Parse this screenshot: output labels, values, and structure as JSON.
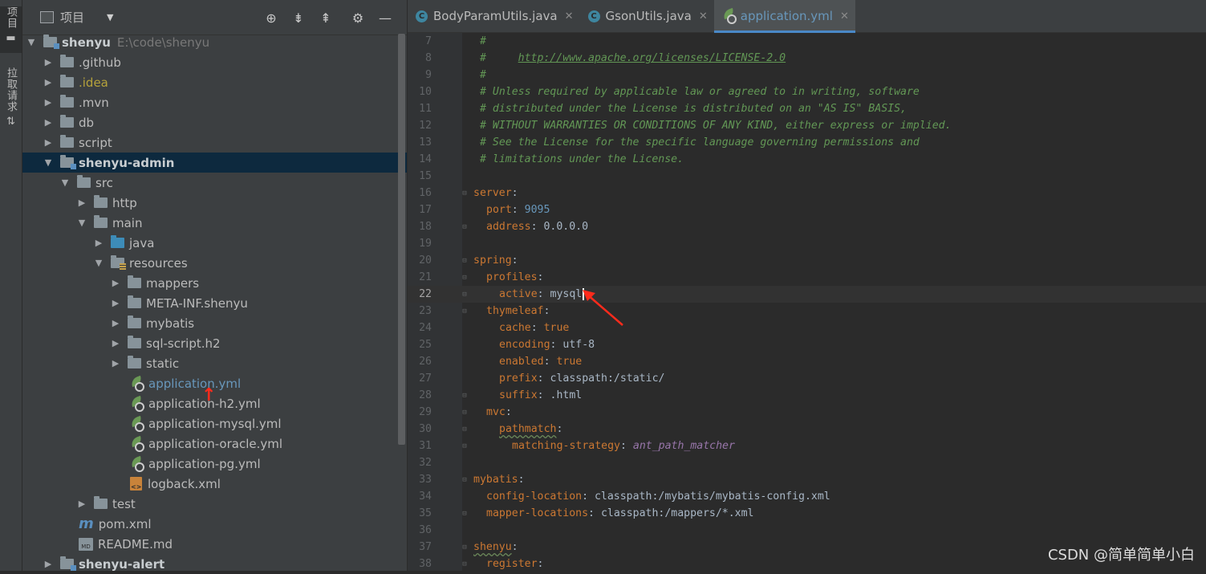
{
  "tool_strip": {
    "project_tab": "项目",
    "pull_requests_tab": "拉取请求"
  },
  "project_panel": {
    "title": "项目",
    "tools": [
      "locate-icon",
      "expand-all-icon",
      "collapse-all-icon",
      "gear-icon",
      "minimize-icon"
    ]
  },
  "tree": [
    {
      "label": "shenyu",
      "path": "E:\\code\\shenyu"
    },
    {
      "label": ".github"
    },
    {
      "label": ".idea"
    },
    {
      "label": ".mvn"
    },
    {
      "label": "db"
    },
    {
      "label": "script"
    },
    {
      "label": "shenyu-admin"
    },
    {
      "label": "src"
    },
    {
      "label": "http"
    },
    {
      "label": "main"
    },
    {
      "label": "java"
    },
    {
      "label": "resources"
    },
    {
      "label": "mappers"
    },
    {
      "label": "META-INF.shenyu"
    },
    {
      "label": "mybatis"
    },
    {
      "label": "sql-script.h2"
    },
    {
      "label": "static"
    },
    {
      "label": "application.yml"
    },
    {
      "label": "application-h2.yml"
    },
    {
      "label": "application-mysql.yml"
    },
    {
      "label": "application-oracle.yml"
    },
    {
      "label": "application-pg.yml"
    },
    {
      "label": "logback.xml"
    },
    {
      "label": "test"
    },
    {
      "label": "pom.xml"
    },
    {
      "label": "README.md"
    },
    {
      "label": "shenyu-alert"
    }
  ],
  "editor_tabs": [
    {
      "label": "BodyParamUtils.java",
      "icon": "java-class-icon"
    },
    {
      "label": "GsonUtils.java",
      "icon": "java-class-icon"
    },
    {
      "label": "application.yml",
      "icon": "spring-yml-icon"
    }
  ],
  "code": {
    "l7": {
      "n": "7",
      "c": "#"
    },
    "l8": {
      "n": "8",
      "pre": "#     ",
      "url": "http://www.apache.org/licenses/LICENSE-2.0"
    },
    "l9": {
      "n": "9",
      "c": "#"
    },
    "l10": {
      "n": "10",
      "c": "# Unless required by applicable law or agreed to in writing, software"
    },
    "l11": {
      "n": "11",
      "c": "# distributed under the License is distributed on an \"AS IS\" BASIS,"
    },
    "l12": {
      "n": "12",
      "c": "# WITHOUT WARRANTIES OR CONDITIONS OF ANY KIND, either express or implied."
    },
    "l13": {
      "n": "13",
      "c": "# See the License for the specific language governing permissions and"
    },
    "l14": {
      "n": "14",
      "c": "# limitations under the License."
    },
    "l15": {
      "n": "15"
    },
    "l16": {
      "n": "16",
      "k": "server"
    },
    "l17": {
      "n": "17",
      "k": "port",
      "v": "9095"
    },
    "l18": {
      "n": "18",
      "k": "address",
      "v": "0.0.0.0"
    },
    "l19": {
      "n": "19"
    },
    "l20": {
      "n": "20",
      "k": "spring"
    },
    "l21": {
      "n": "21",
      "k": "profiles"
    },
    "l22": {
      "n": "22",
      "k": "active",
      "v": "mysql"
    },
    "l23": {
      "n": "23",
      "k": "thymeleaf"
    },
    "l24": {
      "n": "24",
      "k": "cache",
      "v": "true"
    },
    "l25": {
      "n": "25",
      "k": "encoding",
      "v": "utf-8"
    },
    "l26": {
      "n": "26",
      "k": "enabled",
      "v": "true"
    },
    "l27": {
      "n": "27",
      "k": "prefix",
      "v": "classpath:/static/"
    },
    "l28": {
      "n": "28",
      "k": "suffix",
      "v": ".html"
    },
    "l29": {
      "n": "29",
      "k": "mvc"
    },
    "l30": {
      "n": "30",
      "k": "pathmatch"
    },
    "l31": {
      "n": "31",
      "k": "matching-strategy",
      "v": "ant_path_matcher"
    },
    "l32": {
      "n": "32"
    },
    "l33": {
      "n": "33",
      "k": "mybatis"
    },
    "l34": {
      "n": "34",
      "k": "config-location",
      "v": "classpath:/mybatis/mybatis-config.xml"
    },
    "l35": {
      "n": "35",
      "k": "mapper-locations",
      "v": "classpath:/mappers/*.xml"
    },
    "l36": {
      "n": "36"
    },
    "l37": {
      "n": "37",
      "k": "shenyu"
    },
    "l38": {
      "n": "38",
      "k": "register"
    }
  },
  "watermark": "CSDN @简单简单小白",
  "colors": {
    "comment": "#629755",
    "key": "#cc7832",
    "number": "#6897bb",
    "selection": "#0d293e",
    "annotation_arrow": "#ff2b1c"
  }
}
